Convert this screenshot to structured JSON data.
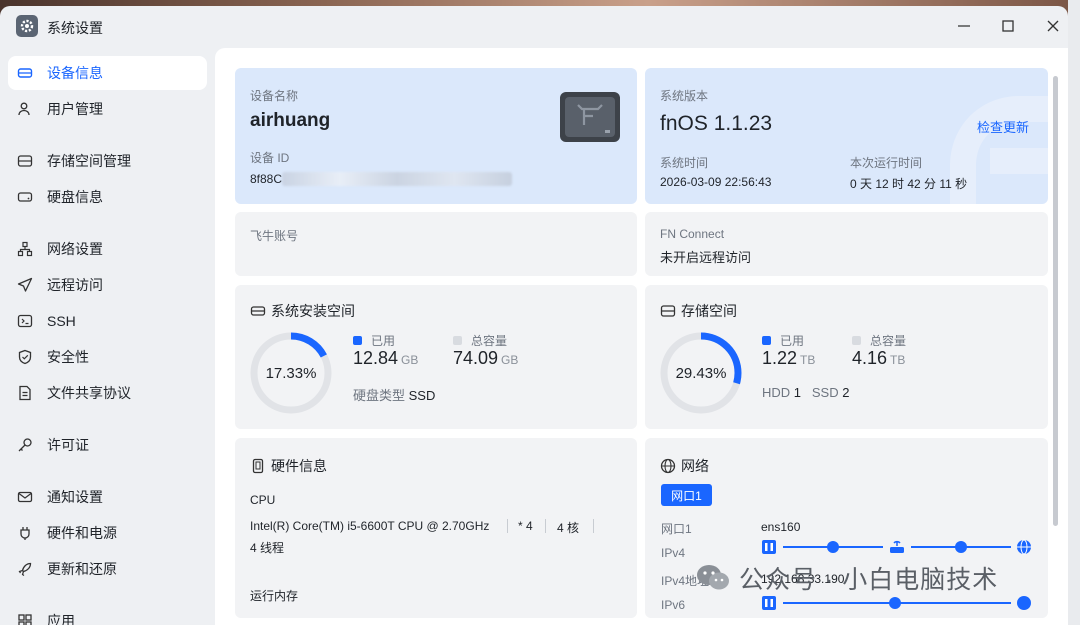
{
  "window": {
    "title": "系统设置"
  },
  "sidebar": {
    "items": [
      {
        "label": "设备信息"
      },
      {
        "label": "用户管理"
      },
      {
        "label": "存储空间管理"
      },
      {
        "label": "硬盘信息"
      },
      {
        "label": "网络设置"
      },
      {
        "label": "远程访问"
      },
      {
        "label": "SSH"
      },
      {
        "label": "安全性"
      },
      {
        "label": "文件共享协议"
      },
      {
        "label": "许可证"
      },
      {
        "label": "通知设置"
      },
      {
        "label": "硬件和电源"
      },
      {
        "label": "更新和还原"
      },
      {
        "label": "应用"
      }
    ]
  },
  "device": {
    "name_label": "设备名称",
    "name": "airhuang",
    "id_label": "设备 ID",
    "id_prefix": "8f88C"
  },
  "system": {
    "version_label": "系统版本",
    "version": "fnOS  1.1.23",
    "update_link": "检查更新",
    "time_label": "系统时间",
    "time": "2026-03-09 22:56:43",
    "uptime_label": "本次运行时间",
    "uptime": "0 天 12 时 42 分 11 秒"
  },
  "account": {
    "label": "飞牛账号"
  },
  "fn_connect": {
    "label": "FN Connect",
    "value": "未开启远程访问"
  },
  "sys_space": {
    "title": "系统安装空间",
    "percent": "17.33%",
    "fraction": 0.1733,
    "used_label": "已用",
    "used": "12.84",
    "used_unit": "GB",
    "total_label": "总容量",
    "total": "74.09",
    "total_unit": "GB",
    "disk_type_label": "硬盘类型",
    "disk_type": "SSD"
  },
  "storage": {
    "title": "存储空间",
    "percent": "29.43%",
    "fraction": 0.2943,
    "used_label": "已用",
    "used": "1.22",
    "used_unit": "TB",
    "total_label": "总容量",
    "total": "4.16",
    "total_unit": "TB",
    "hdd_label": "HDD",
    "hdd": "1",
    "ssd_label": "SSD",
    "ssd": "2"
  },
  "hardware": {
    "title": "硬件信息",
    "cpu_label": "CPU",
    "cpu": "Intel(R) Core(TM) i5-6600T CPU @ 2.70GHz",
    "cpu_count": "* 4",
    "cores": "4 核",
    "threads": "4 线程",
    "memory_label": "运行内存"
  },
  "network": {
    "title": "网络",
    "port_button": "网口1",
    "port_label": "网口1",
    "port_value": "ens160",
    "ipv4_label": "IPv4",
    "ipv4_addr_label": "IPv4地址",
    "ipv4_addr": "192.168.33.190",
    "ipv6_label": "IPv6"
  },
  "watermark": {
    "text": "公众号 · 小白电脑技术"
  },
  "colors": {
    "accent": "#1a66ff",
    "ring_track": "#e1e3e7",
    "card": "#f2f3f5",
    "card_blue": "#dbe8fb"
  }
}
